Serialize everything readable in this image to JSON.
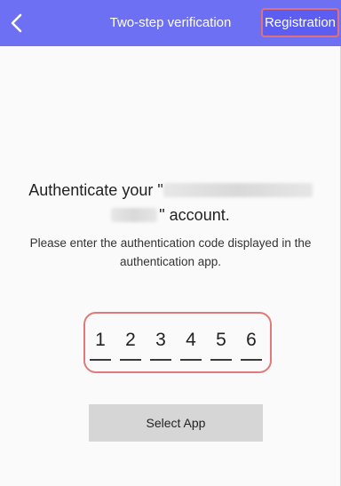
{
  "header": {
    "title": "Two-step verification",
    "back_icon": "chevron-left-icon",
    "registration_label": "Registration",
    "background_color": "#6e70f3"
  },
  "auth": {
    "line1_prefix": "Authenticate your \"",
    "line2_suffix": "\" account.",
    "hint": "Please enter the authentication code displayed in the authentication app."
  },
  "code": {
    "digits": [
      "1",
      "2",
      "3",
      "4",
      "5",
      "6"
    ]
  },
  "select_app": {
    "label": "Select App"
  },
  "colors": {
    "highlight": "#e07a7a",
    "button_bg": "#d6d6d6"
  }
}
